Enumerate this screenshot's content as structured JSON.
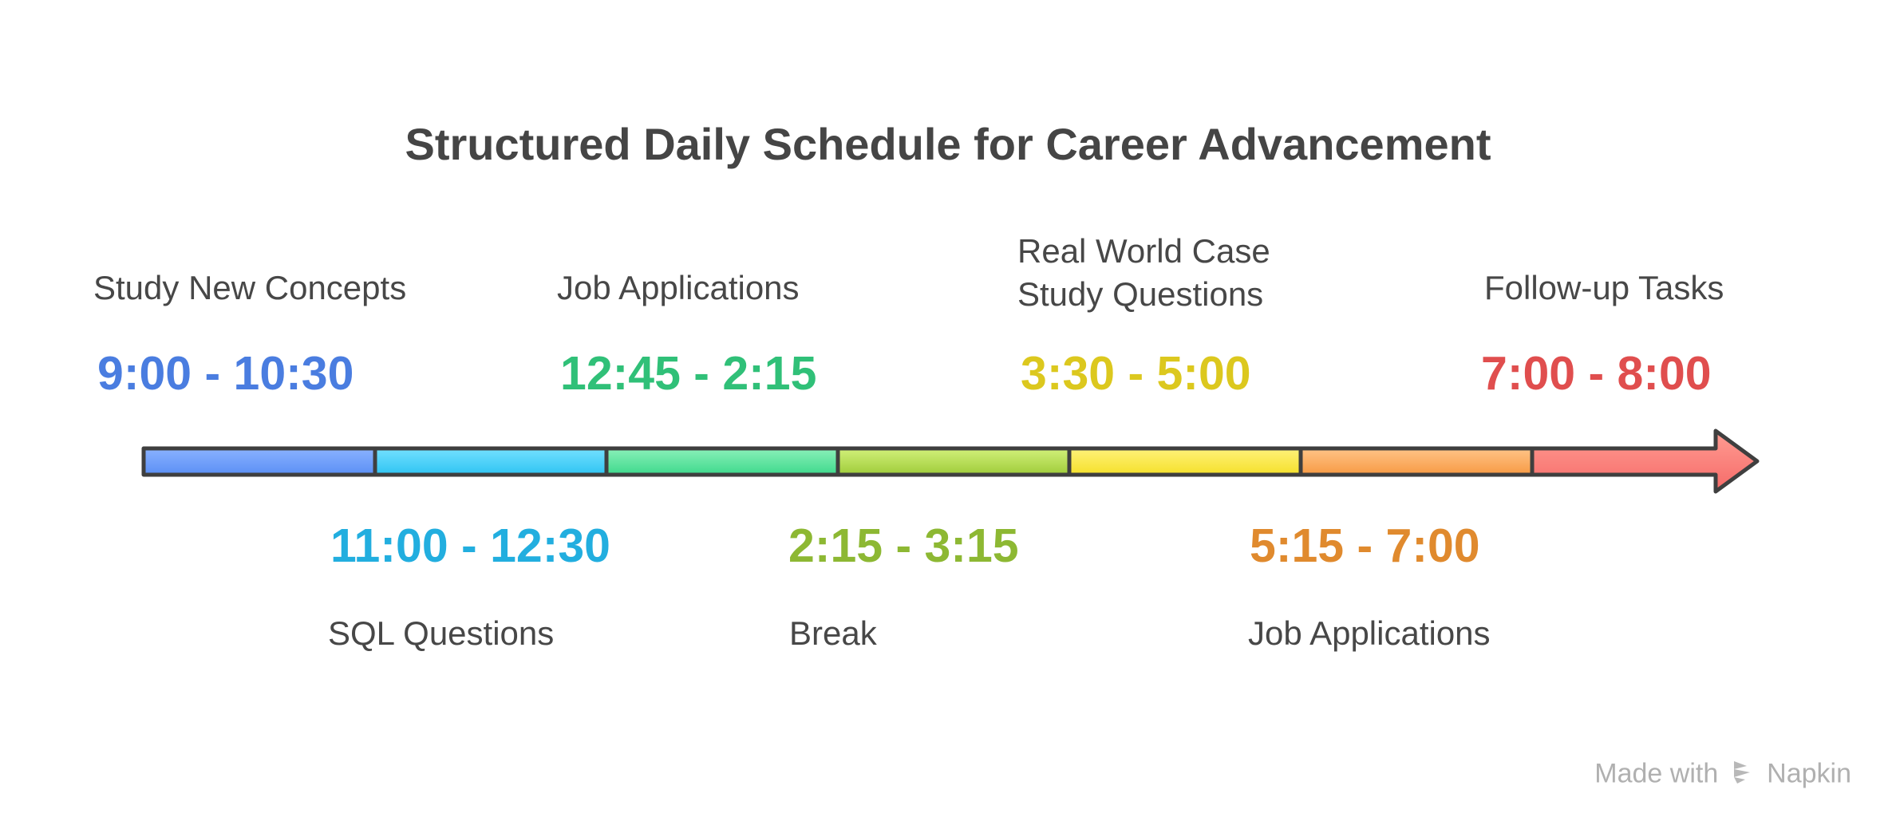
{
  "title": "Structured Daily Schedule for Career Advancement",
  "slots": [
    {
      "time": "9:00 - 10:30",
      "label": [
        "Study New Concepts"
      ],
      "color": "#4A7DE0",
      "fill_top": "#8AB2FF",
      "fill_bottom": "#5B8FF5",
      "position": "top"
    },
    {
      "time": "11:00 - 12:30",
      "label": [
        "SQL Questions"
      ],
      "color": "#22AEDF",
      "fill_top": "#73E0FF",
      "fill_bottom": "#2FC4F2",
      "position": "bottom"
    },
    {
      "time": "12:45 - 2:15",
      "label": [
        "Job Applications"
      ],
      "color": "#30C078",
      "fill_top": "#8AF0B9",
      "fill_bottom": "#3ED98C",
      "position": "top"
    },
    {
      "time": "2:15 - 3:15",
      "label": [
        "Break"
      ],
      "color": "#8DB833",
      "fill_top": "#D2F07A",
      "fill_bottom": "#9FCC3A",
      "position": "bottom"
    },
    {
      "time": "3:30 - 5:00",
      "label": [
        "Real World Case",
        "Study Questions"
      ],
      "color": "#DCC81E",
      "fill_top": "#FFF27A",
      "fill_bottom": "#F5E02A",
      "position": "top"
    },
    {
      "time": "5:15 - 7:00",
      "label": [
        "Job Applications"
      ],
      "color": "#E08A2E",
      "fill_top": "#FFC487",
      "fill_bottom": "#F79A44",
      "position": "bottom"
    },
    {
      "time": "7:00 - 8:00",
      "label": [
        "Follow-up Tasks"
      ],
      "color": "#E04E4E",
      "fill_top": "#FF9D93",
      "fill_bottom": "#F66A68",
      "position": "top"
    }
  ],
  "footer": {
    "prefix": "Made with",
    "brand": "Napkin"
  }
}
